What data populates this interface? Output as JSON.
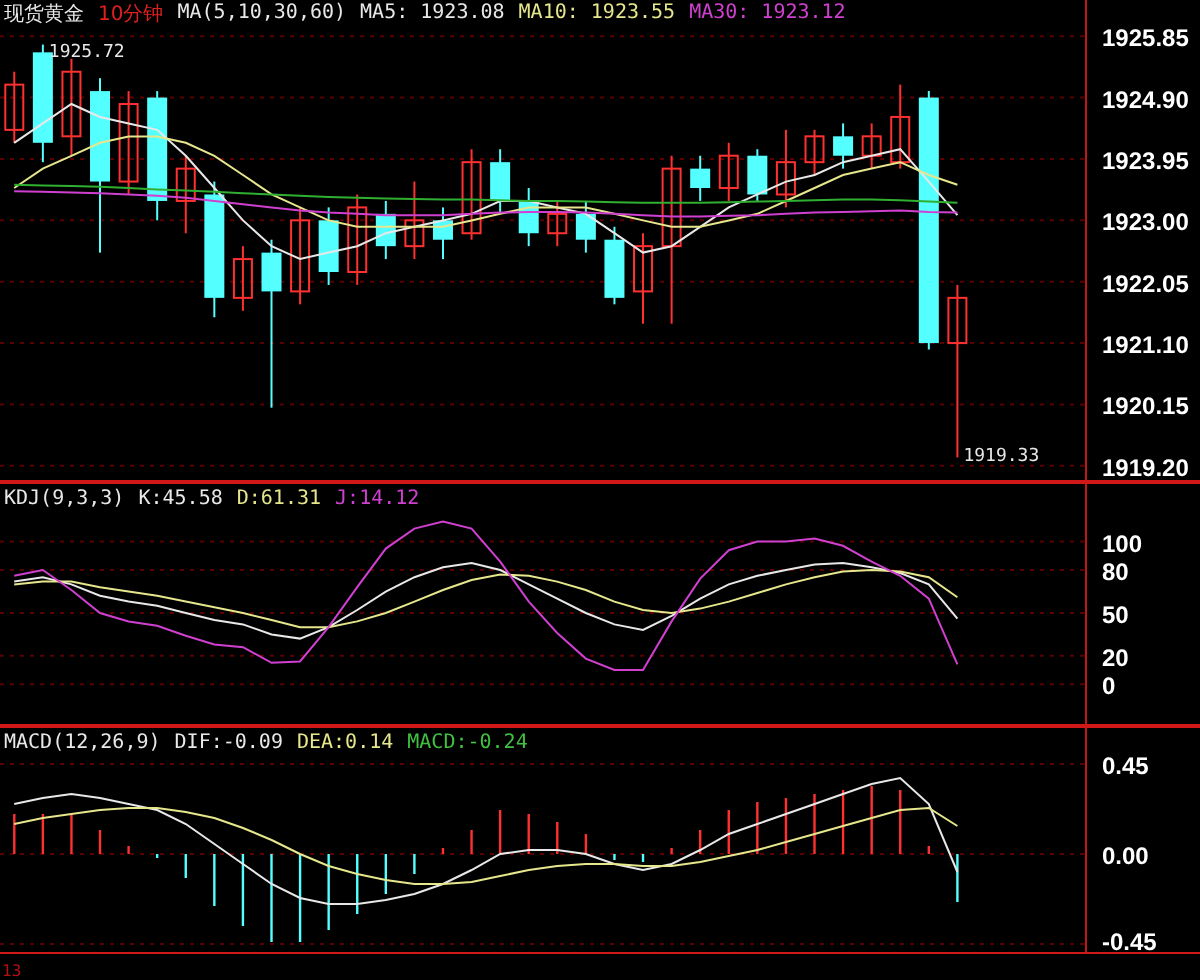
{
  "main_panel": {
    "title": "现货黄金",
    "timeframe": "10分钟",
    "legend": [
      {
        "text": "MA(5,10,30,60)",
        "color": "#e8e8e8"
      },
      {
        "text": "MA5: 1923.08",
        "color": "#e8e8e8"
      },
      {
        "text": "MA10: 1923.55",
        "color": "#e6e68c"
      },
      {
        "text": "MA30: 1923.12",
        "color": "#d040d0"
      }
    ],
    "chart_data": {
      "type": "candlestick",
      "grid": true,
      "ylim": [
        1918.95,
        1926.41
      ],
      "yticks": [
        {
          "value": 1925.85,
          "label": "1925.85"
        },
        {
          "value": 1924.9,
          "label": "1924.90"
        },
        {
          "value": 1923.95,
          "label": "1923.95"
        },
        {
          "value": 1923.0,
          "label": "1923.00"
        },
        {
          "value": 1922.05,
          "label": "1922.05"
        },
        {
          "value": 1921.1,
          "label": "1921.10"
        },
        {
          "value": 1920.15,
          "label": "1920.15"
        },
        {
          "value": 1919.2,
          "label": "1919.20"
        }
      ],
      "ohlc": [
        [
          1924.4,
          1925.3,
          1924.2,
          1925.1
        ],
        [
          1925.6,
          1925.72,
          1923.9,
          1924.2
        ],
        [
          1924.3,
          1925.5,
          1924.0,
          1925.3
        ],
        [
          1925.0,
          1925.2,
          1922.5,
          1923.6
        ],
        [
          1923.6,
          1925.0,
          1923.4,
          1924.8
        ],
        [
          1924.9,
          1925.0,
          1923.0,
          1923.3
        ],
        [
          1923.3,
          1924.0,
          1922.8,
          1923.8
        ],
        [
          1923.4,
          1923.6,
          1921.5,
          1921.8
        ],
        [
          1921.8,
          1922.6,
          1921.6,
          1922.4
        ],
        [
          1922.5,
          1922.7,
          1920.1,
          1921.9
        ],
        [
          1921.9,
          1923.2,
          1921.7,
          1923.0
        ],
        [
          1923.0,
          1923.2,
          1922.0,
          1922.2
        ],
        [
          1922.2,
          1923.4,
          1922.0,
          1923.2
        ],
        [
          1923.1,
          1923.3,
          1922.4,
          1922.6
        ],
        [
          1922.6,
          1923.6,
          1922.4,
          1923.0
        ],
        [
          1923.0,
          1923.2,
          1922.4,
          1922.7
        ],
        [
          1922.8,
          1924.1,
          1922.7,
          1923.9
        ],
        [
          1923.9,
          1924.1,
          1923.1,
          1923.3
        ],
        [
          1923.3,
          1923.5,
          1922.6,
          1922.8
        ],
        [
          1922.8,
          1923.3,
          1922.6,
          1923.1
        ],
        [
          1923.1,
          1923.3,
          1922.5,
          1922.7
        ],
        [
          1922.7,
          1922.9,
          1921.7,
          1921.8
        ],
        [
          1921.9,
          1922.8,
          1921.4,
          1922.6
        ],
        [
          1922.6,
          1924.0,
          1921.4,
          1923.8
        ],
        [
          1923.8,
          1924.0,
          1923.3,
          1923.5
        ],
        [
          1923.5,
          1924.2,
          1923.3,
          1924.0
        ],
        [
          1924.0,
          1924.1,
          1923.3,
          1923.4
        ],
        [
          1923.4,
          1924.4,
          1923.2,
          1923.9
        ],
        [
          1923.9,
          1924.4,
          1923.7,
          1924.3
        ],
        [
          1924.3,
          1924.5,
          1923.8,
          1924.0
        ],
        [
          1924.0,
          1924.5,
          1923.8,
          1924.3
        ],
        [
          1923.9,
          1925.1,
          1923.8,
          1924.6
        ],
        [
          1924.9,
          1925.0,
          1921.0,
          1921.1
        ],
        [
          1921.1,
          1922.0,
          1919.33,
          1921.8
        ],
        null,
        null,
        null,
        null
      ],
      "series": [
        {
          "type": "line",
          "color": "#e8e8e8",
          "values": [
            1924.2,
            1924.5,
            1924.8,
            1924.6,
            1924.5,
            1924.4,
            1924.0,
            1923.5,
            1923.0,
            1922.6,
            1922.4,
            1922.5,
            1922.6,
            1922.8,
            1922.9,
            1923.0,
            1923.1,
            1923.3,
            1923.3,
            1923.2,
            1923.1,
            1922.8,
            1922.5,
            1922.6,
            1922.9,
            1923.2,
            1923.4,
            1923.6,
            1923.7,
            1923.9,
            1924.0,
            1924.1,
            1923.6,
            1923.08,
            null,
            null,
            null,
            null
          ]
        },
        {
          "type": "line",
          "color": "#e6e68c",
          "values": [
            1923.5,
            1923.8,
            1924.0,
            1924.2,
            1924.3,
            1924.3,
            1924.2,
            1924.0,
            1923.7,
            1923.4,
            1923.2,
            1923.0,
            1922.9,
            1922.9,
            1922.9,
            1922.9,
            1923.0,
            1923.1,
            1923.2,
            1923.2,
            1923.2,
            1923.1,
            1923.0,
            1922.9,
            1922.9,
            1923.0,
            1923.1,
            1923.3,
            1923.5,
            1923.7,
            1923.8,
            1923.9,
            1923.7,
            1923.55,
            null,
            null,
            null,
            null
          ]
        },
        {
          "type": "line",
          "color": "#d040d0",
          "values": [
            1923.45,
            1923.44,
            1923.43,
            1923.42,
            1923.4,
            1923.38,
            1923.35,
            1923.3,
            1923.25,
            1923.2,
            1923.15,
            1923.12,
            1923.1,
            1923.08,
            1923.08,
            1923.08,
            1923.1,
            1923.12,
            1923.13,
            1923.13,
            1923.12,
            1923.1,
            1923.08,
            1923.06,
            1923.06,
            1923.07,
            1923.08,
            1923.1,
            1923.12,
            1923.13,
            1923.14,
            1923.15,
            1923.13,
            1923.12,
            null,
            null,
            null,
            null
          ]
        },
        {
          "type": "line",
          "color": "#30b030",
          "values": [
            1923.55,
            1923.54,
            1923.53,
            1923.52,
            1923.5,
            1923.48,
            1923.46,
            1923.44,
            1923.42,
            1923.4,
            1923.38,
            1923.36,
            1923.35,
            1923.34,
            1923.33,
            1923.32,
            1923.32,
            1923.31,
            1923.3,
            1923.3,
            1923.29,
            1923.28,
            1923.27,
            1923.27,
            1923.27,
            1923.28,
            1923.29,
            1923.3,
            1923.31,
            1923.32,
            1923.32,
            1923.31,
            1923.29,
            1923.27,
            null,
            null,
            null,
            null
          ]
        }
      ],
      "annotations": [
        "1925.72",
        "1919.33"
      ]
    }
  },
  "kdj_panel": {
    "legend": [
      {
        "text": "KDJ(9,3,3)",
        "color": "#e8e8e8"
      },
      {
        "text": "K:45.58",
        "color": "#e8e8e8"
      },
      {
        "text": "D:61.31",
        "color": "#e6e68c"
      },
      {
        "text": "J:14.12",
        "color": "#d040d0"
      }
    ],
    "chart_data": {
      "type": "line",
      "grid": true,
      "ylim": [
        -29.2,
        141.7
      ],
      "yticks": [
        {
          "value": 100,
          "label": "100"
        },
        {
          "value": 80,
          "label": "80"
        },
        {
          "value": 50,
          "label": "50"
        },
        {
          "value": 20,
          "label": "20"
        },
        {
          "value": 0,
          "label": "0"
        }
      ],
      "series": [
        {
          "color": "#e8e8e8",
          "values": [
            72,
            75,
            70,
            62,
            58,
            55,
            50,
            45,
            42,
            35,
            32,
            40,
            52,
            65,
            75,
            82,
            85,
            80,
            70,
            60,
            50,
            42,
            38,
            48,
            60,
            70,
            76,
            80,
            84,
            85,
            82,
            78,
            70,
            46,
            null,
            null,
            null,
            null
          ]
        },
        {
          "color": "#e6e68c",
          "values": [
            70,
            72,
            72,
            68,
            65,
            62,
            58,
            54,
            50,
            45,
            40,
            40,
            44,
            50,
            58,
            66,
            73,
            77,
            76,
            72,
            66,
            58,
            52,
            50,
            53,
            58,
            64,
            70,
            75,
            79,
            80,
            79,
            75,
            61,
            null,
            null,
            null,
            null
          ]
        },
        {
          "color": "#d040d0",
          "values": [
            76,
            80,
            66,
            50,
            44,
            41,
            34,
            28,
            26,
            15,
            16,
            40,
            68,
            95,
            109,
            114,
            109,
            86,
            58,
            36,
            18,
            10,
            10,
            44,
            74,
            94,
            100,
            100,
            102,
            97,
            86,
            76,
            60,
            14,
            null,
            null,
            null,
            null
          ]
        }
      ]
    }
  },
  "macd_panel": {
    "legend": [
      {
        "text": "MACD(12,26,9)",
        "color": "#e8e8e8"
      },
      {
        "text": "DIF:-0.09",
        "color": "#e8e8e8"
      },
      {
        "text": "DEA:0.14",
        "color": "#e6e68c"
      },
      {
        "text": "MACD:-0.24",
        "color": "#40c040"
      }
    ],
    "chart_data": {
      "type": "line",
      "grid": true,
      "ylim": [
        -0.5,
        0.64
      ],
      "yticks": [
        {
          "value": 0.45,
          "label": "0.45"
        },
        {
          "value": 0,
          "label": "0.00"
        },
        {
          "value": -0.45,
          "label": "-0.45"
        }
      ],
      "series": [
        {
          "type": "bar",
          "values": [
            0.2,
            0.2,
            0.2,
            0.12,
            0.04,
            -0.02,
            -0.12,
            -0.26,
            -0.36,
            -0.44,
            -0.44,
            -0.38,
            -0.3,
            -0.2,
            -0.1,
            0.03,
            0.12,
            0.22,
            0.2,
            0.16,
            0.1,
            -0.03,
            -0.04,
            0.03,
            0.12,
            0.22,
            0.26,
            0.28,
            0.3,
            0.32,
            0.34,
            0.32,
            0.04,
            -0.24,
            null,
            null,
            null,
            null
          ],
          "colors": [
            "#ff3030",
            "#ff3030",
            "#ff3030",
            "#ff3030",
            "#ff3030",
            "#54ffff",
            "#54ffff",
            "#54ffff",
            "#54ffff",
            "#54ffff",
            "#54ffff",
            "#54ffff",
            "#54ffff",
            "#54ffff",
            "#54ffff",
            "#ff3030",
            "#ff3030",
            "#ff3030",
            "#ff3030",
            "#ff3030",
            "#ff3030",
            "#54ffff",
            "#54ffff",
            "#ff3030",
            "#ff3030",
            "#ff3030",
            "#ff3030",
            "#ff3030",
            "#ff3030",
            "#ff3030",
            "#ff3030",
            "#ff3030",
            "#ff3030",
            "#54ffff",
            null,
            null,
            null,
            null
          ]
        },
        {
          "type": "line",
          "color": "#e8e8e8",
          "values": [
            0.25,
            0.28,
            0.3,
            0.28,
            0.25,
            0.22,
            0.15,
            0.05,
            -0.05,
            -0.15,
            -0.22,
            -0.25,
            -0.25,
            -0.23,
            -0.2,
            -0.15,
            -0.08,
            0.0,
            0.02,
            0.02,
            0.0,
            -0.05,
            -0.08,
            -0.05,
            0.02,
            0.1,
            0.15,
            0.2,
            0.25,
            0.3,
            0.35,
            0.38,
            0.25,
            -0.09,
            null,
            null,
            null,
            null
          ]
        },
        {
          "type": "line",
          "color": "#e6e68c",
          "values": [
            0.15,
            0.18,
            0.2,
            0.22,
            0.23,
            0.23,
            0.21,
            0.18,
            0.13,
            0.07,
            0.0,
            -0.06,
            -0.1,
            -0.13,
            -0.15,
            -0.15,
            -0.14,
            -0.11,
            -0.08,
            -0.06,
            -0.05,
            -0.05,
            -0.06,
            -0.06,
            -0.04,
            -0.01,
            0.02,
            0.06,
            0.1,
            0.14,
            0.18,
            0.22,
            0.23,
            0.14,
            null,
            null,
            null,
            null
          ]
        }
      ]
    }
  },
  "footer_label": "13"
}
